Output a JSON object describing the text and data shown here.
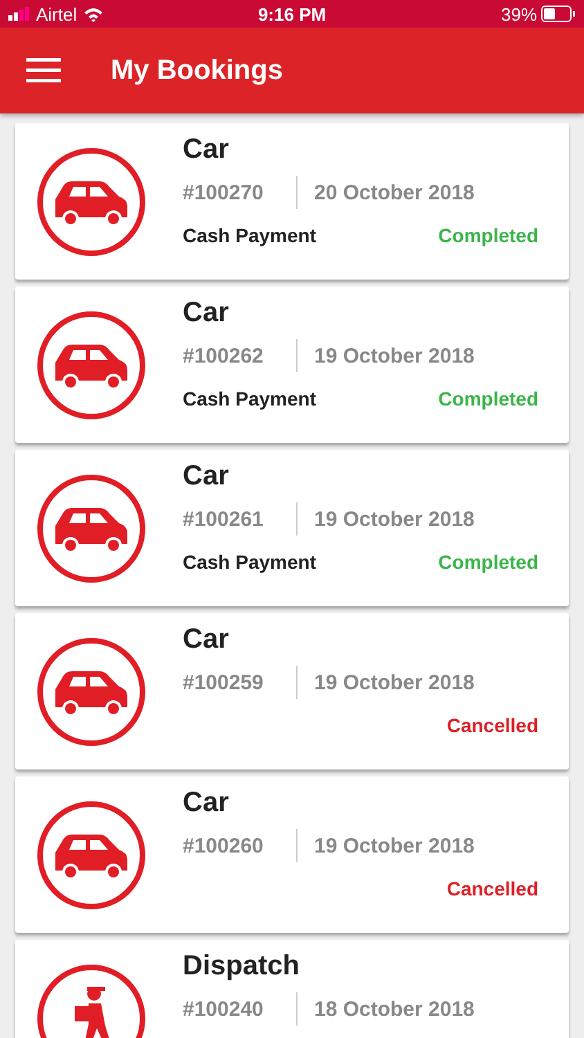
{
  "status_bar": {
    "carrier": "Airtel",
    "time": "9:16 PM",
    "battery": "39%"
  },
  "header": {
    "title": "My Bookings"
  },
  "bookings": [
    {
      "kind": "car",
      "title": "Car",
      "id": "#100270",
      "date": "20 October 2018",
      "payment": "Cash Payment",
      "status": {
        "text": "Completed",
        "color": "#3bb54a"
      }
    },
    {
      "kind": "car",
      "title": "Car",
      "id": "#100262",
      "date": "19 October 2018",
      "payment": "Cash Payment",
      "status": {
        "text": "Completed",
        "color": "#3bb54a"
      }
    },
    {
      "kind": "car",
      "title": "Car",
      "id": "#100261",
      "date": "19 October 2018",
      "payment": "Cash Payment",
      "status": {
        "text": "Completed",
        "color": "#3bb54a"
      }
    },
    {
      "kind": "car",
      "title": "Car",
      "id": "#100259",
      "date": "19 October 2018",
      "status": {
        "text": "Cancelled",
        "color": "#dd1f26"
      }
    },
    {
      "kind": "car",
      "title": "Car",
      "id": "#100260",
      "date": "19 October 2018",
      "status": {
        "text": "Cancelled",
        "color": "#dd1f26"
      }
    },
    {
      "kind": "courier",
      "title": "Dispatch",
      "id": "#100240",
      "date": "18 October 2018"
    }
  ]
}
